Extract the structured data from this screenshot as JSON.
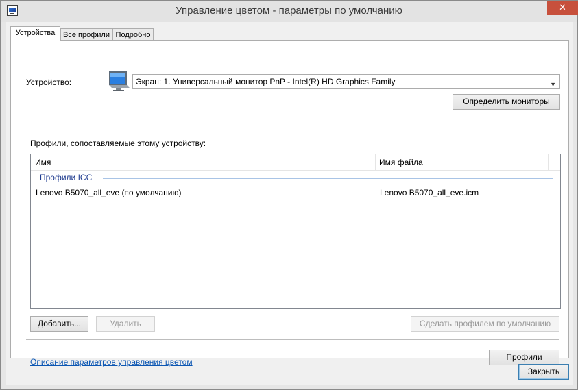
{
  "window": {
    "title": "Управление цветом - параметры по умолчанию",
    "close_glyph": "✕"
  },
  "tabs": [
    {
      "label": "Устройства",
      "active": true
    },
    {
      "label": "Все профили",
      "active": false
    },
    {
      "label": "Подробно",
      "active": false
    }
  ],
  "device": {
    "label": "Устройство:",
    "icon": "monitor-icon",
    "selected": "Экран: 1. Универсальный монитор PnP - Intel(R) HD Graphics Family",
    "identify_button": "Определить мониторы"
  },
  "profiles": {
    "section_label": "Профили, сопоставляемые этому устройству:",
    "columns": [
      "Имя",
      "Имя файла"
    ],
    "group_title": "Профили ICC",
    "rows": [
      {
        "name": "Lenovo B5070_all_eve (по умолчанию)",
        "file": "Lenovo B5070_all_eve.icm"
      }
    ]
  },
  "actions": {
    "add": "Добавить...",
    "remove": "Удалить",
    "set_default": "Сделать профилем по умолчанию"
  },
  "footer": {
    "link": "Описание параметров управления цветом",
    "profiles_button": "Профили",
    "close_button": "Закрыть"
  },
  "colors": {
    "close_red": "#c7503c",
    "link_blue": "#0b56b3",
    "group_blue": "#1e3b8f"
  }
}
